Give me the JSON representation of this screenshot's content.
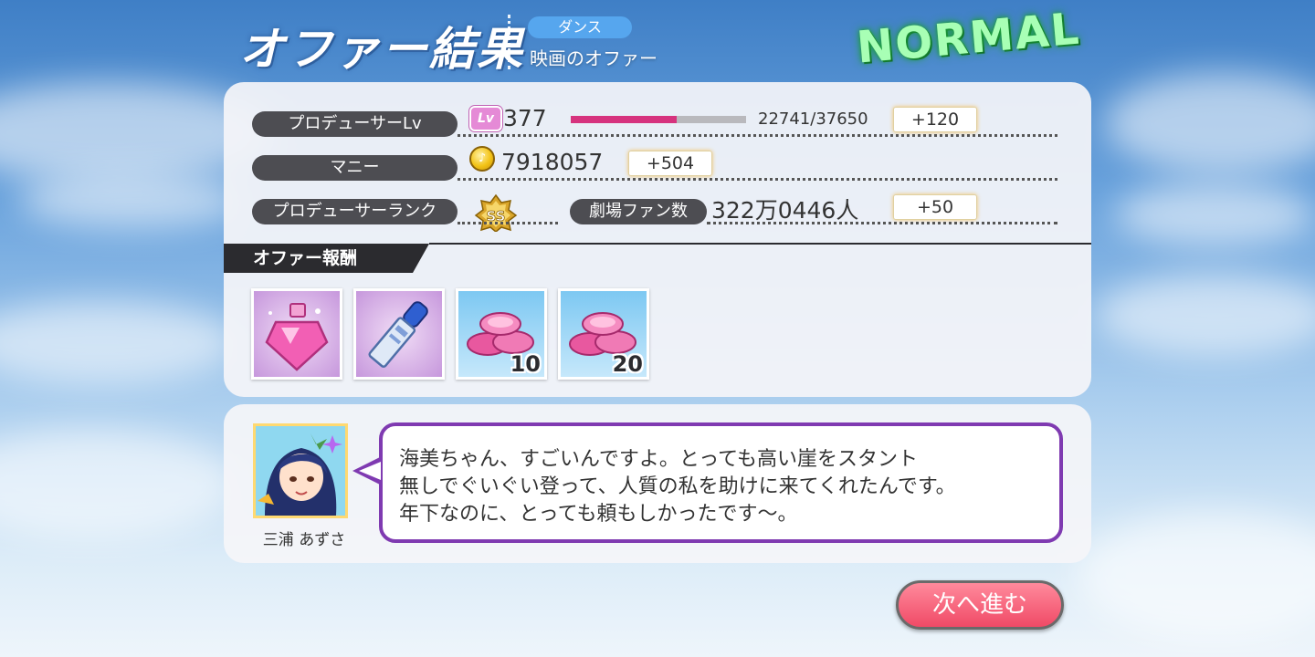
{
  "header": {
    "title": "オファー結果",
    "category": "ダンス",
    "offer_name": "映画のオファー",
    "difficulty": "NORMAL"
  },
  "stats": {
    "producer_lv": {
      "label": "プロデューサーLv",
      "badge": "Lv",
      "level": "377",
      "xp_text": "22741/37650",
      "xp_fraction": 0.604,
      "gain": "+120"
    },
    "money": {
      "label": "マニー",
      "value": "7918057",
      "gain": "+504"
    },
    "rank": {
      "label": "プロデューサーランク",
      "rank_value": "SS"
    },
    "theater_fans": {
      "label": "劇場ファン数",
      "value": "322万0446人",
      "gain": "+50"
    }
  },
  "rewards": {
    "header": "オファー報酬",
    "items": [
      {
        "icon": "perfume-bottle-icon",
        "count": ""
      },
      {
        "icon": "lipstick-icon",
        "count": ""
      },
      {
        "icon": "pink-coins-icon",
        "count": "10"
      },
      {
        "icon": "pink-coins-icon",
        "count": "20"
      }
    ]
  },
  "dialog": {
    "speaker": "三浦 あずさ",
    "lines": [
      "海美ちゃん、すごいんですよ。とっても高い崖をスタント",
      "無しでぐいぐい登って、人質の私を助けに来てくれたんです。",
      "年下なのに、とっても頼もしかったです～。"
    ]
  },
  "next_button": "次へ進む",
  "colors": {
    "xp_bar": "#d6337e",
    "difficulty_glow": "#1d9e3c",
    "bubble_border": "#7f3ab1",
    "next_button": "#f04a66"
  }
}
